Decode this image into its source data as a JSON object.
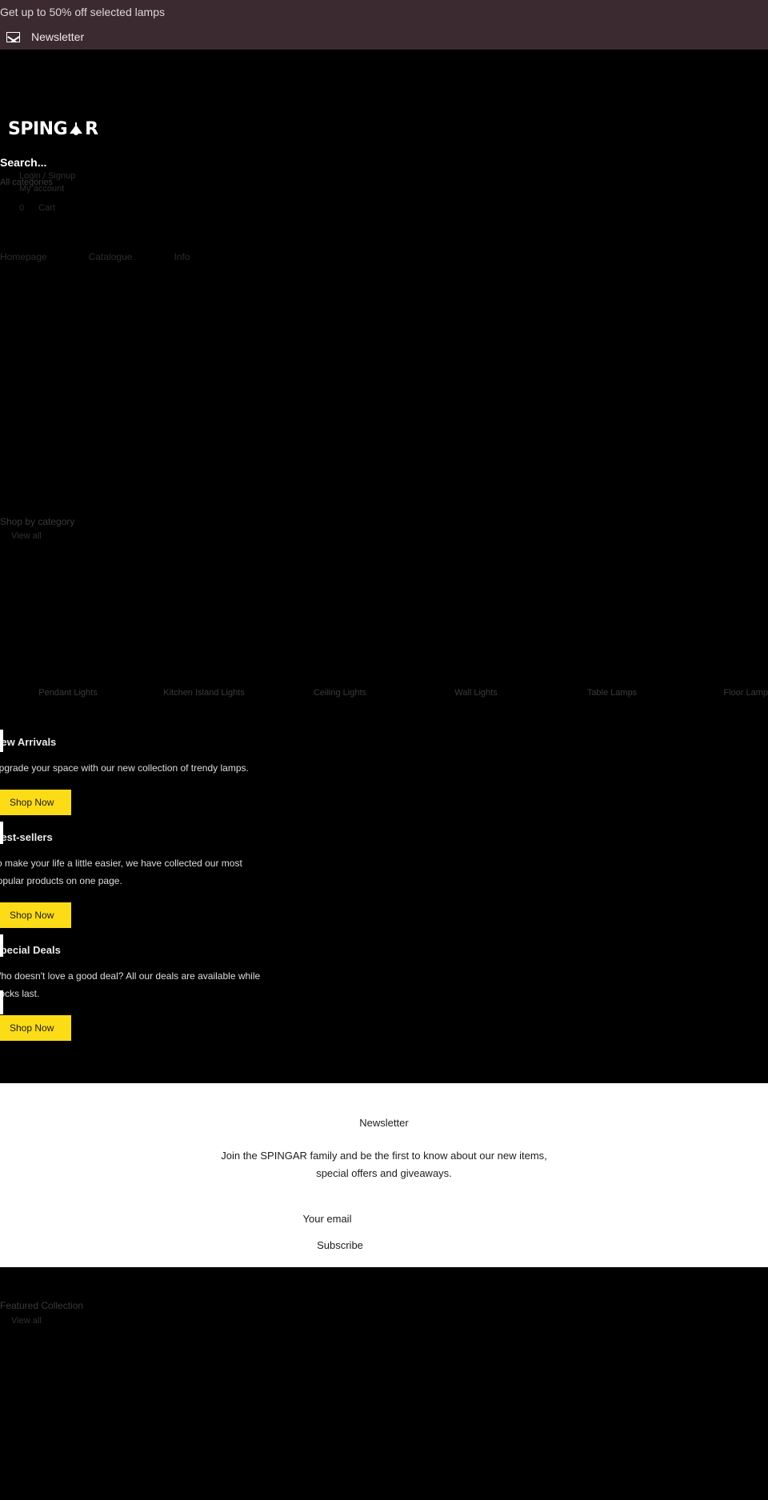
{
  "announcement": {
    "promo_text": "Get up to 50% off selected lamps",
    "newsletter_label": "Newsletter",
    "mail_icon": "mail-icon",
    "background": "#3b2b30"
  },
  "header": {
    "logo_prefix": "SPING",
    "logo_suffix": "R",
    "logo_icon": "lamp-icon",
    "logo_full": "SPINGAR",
    "search_placeholder": "Search...",
    "all_categories": "All categories",
    "login_signup": "Login / Signup",
    "my_account": "My account",
    "cart_count": "0",
    "cart_label": "Cart"
  },
  "nav": {
    "items": [
      {
        "label": "Homepage"
      },
      {
        "label": "Catalogue"
      },
      {
        "label": "Info"
      }
    ]
  },
  "shop_by_category": {
    "title": "Shop by category",
    "view_all": "View all",
    "categories": [
      {
        "label": "Pendant Lights"
      },
      {
        "label": "Kitchen Island Lights"
      },
      {
        "label": "Ceiling Lights"
      },
      {
        "label": "Wall Lights"
      },
      {
        "label": "Table Lamps"
      },
      {
        "label": "Floor Lamps"
      }
    ]
  },
  "promos": [
    {
      "title": "New Arrivals",
      "body": "Upgrade your space with our new collection of trendy lamps.",
      "button": "Shop Now"
    },
    {
      "title": "Best-sellers",
      "body": "To make your life a little easier, we have collected our most popular products on one page.",
      "button": "Shop Now"
    },
    {
      "title": "Special Deals",
      "body": "Who doesn't love a good deal? All our deals are available while stocks last.",
      "button": "Shop Now"
    }
  ],
  "newsletter": {
    "title": "Newsletter",
    "description_line1": "Join the SPINGAR family and be the first to know about our new items,",
    "description_line2": "special offers and giveaways.",
    "email_placeholder": "Your email",
    "subscribe_label": "Subscribe"
  },
  "featured_collection": {
    "title": "Featured Collection",
    "view_all": "View all"
  },
  "colors": {
    "accent_yellow": "#fcdc17",
    "page_background": "#000000",
    "announcement_background": "#3b2b30",
    "newsletter_background": "#ffffff"
  }
}
